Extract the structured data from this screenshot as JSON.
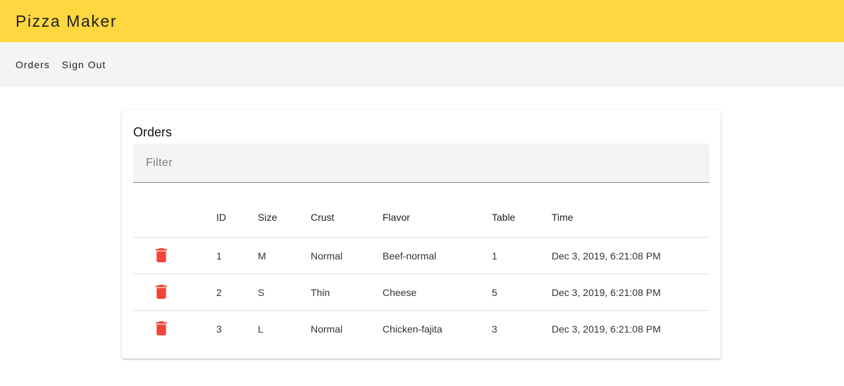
{
  "app": {
    "title": "Pizza Maker"
  },
  "nav": {
    "items": [
      {
        "label": "Orders"
      },
      {
        "label": "Sign Out"
      }
    ]
  },
  "orders_card": {
    "title": "Orders",
    "filter": {
      "placeholder": "Filter",
      "value": ""
    },
    "columns": [
      "",
      "ID",
      "Size",
      "Crust",
      "Flavor",
      "Table",
      "Time"
    ],
    "rows": [
      {
        "id": "1",
        "size": "M",
        "crust": "Normal",
        "flavor": "Beef-normal",
        "table": "1",
        "time": "Dec 3, 2019, 6:21:08 PM"
      },
      {
        "id": "2",
        "size": "S",
        "crust": "Thin",
        "flavor": "Cheese",
        "table": "5",
        "time": "Dec 3, 2019, 6:21:08 PM"
      },
      {
        "id": "3",
        "size": "L",
        "crust": "Normal",
        "flavor": "Chicken-fajita",
        "table": "3",
        "time": "Dec 3, 2019, 6:21:08 PM"
      }
    ]
  },
  "icons": {
    "delete": "trash-icon"
  },
  "colors": {
    "app_bar": "#ffd740",
    "nav_bar": "#f4f4f4",
    "delete_icon": "#f44336"
  }
}
